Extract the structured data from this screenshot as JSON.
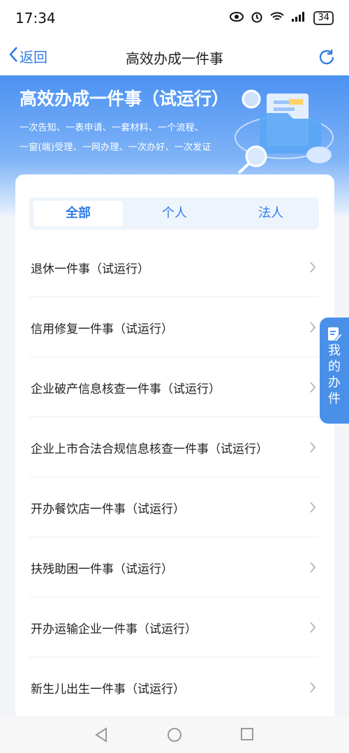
{
  "status": {
    "time": "17:34",
    "battery": "34"
  },
  "nav": {
    "back_label": "返回",
    "title": "高效办成一件事"
  },
  "banner": {
    "title": "高效办成一件事（试运行）",
    "line1": "一次告知、一表申请、一套材料、一个流程、",
    "line2": "一窗(端)受理、一网办理、一次办好、一次发证"
  },
  "tabs": [
    {
      "label": "全部",
      "active": true
    },
    {
      "label": "个人",
      "active": false
    },
    {
      "label": "法人",
      "active": false
    }
  ],
  "items": [
    {
      "label": "退休一件事（试运行）"
    },
    {
      "label": "信用修复一件事（试运行）"
    },
    {
      "label": "企业破产信息核查一件事（试运行）"
    },
    {
      "label": "企业上市合法合规信息核查一件事（试运行）"
    },
    {
      "label": "开办餐饮店一件事（试运行）"
    },
    {
      "label": "扶残助困一件事（试运行）"
    },
    {
      "label": "开办运输企业一件事（试运行）"
    },
    {
      "label": "新生儿出生一件事（试运行）"
    }
  ],
  "float_tab": {
    "chars": [
      "我",
      "的",
      "办",
      "件"
    ]
  },
  "colors": {
    "accent": "#2f7be8",
    "banner": "#4b92f2"
  }
}
